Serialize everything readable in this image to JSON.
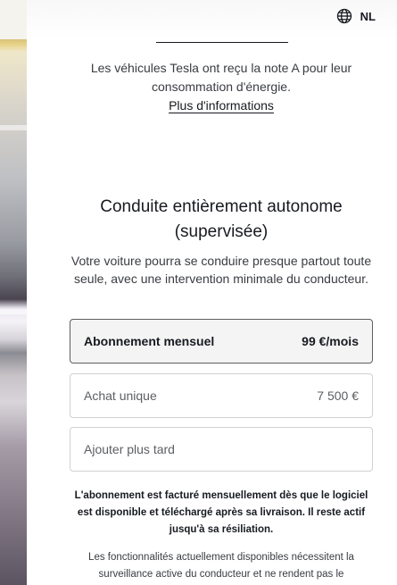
{
  "header": {
    "language_code": "NL",
    "globe_icon": "globe-icon"
  },
  "energy": {
    "note": "Les véhicules Tesla ont reçu la note A pour leur consommation d'énergie.",
    "link": "Plus d'informations"
  },
  "fsd": {
    "title": "Conduite entièrement autonome (supervisée)",
    "description": "Votre voiture pourra se conduire presque partout toute seule, avec une intervention minimale du conducteur.",
    "options": [
      {
        "label": "Abonnement mensuel",
        "price": "99 €/mois",
        "selected": true
      },
      {
        "label": "Achat unique",
        "price": "7 500 €",
        "selected": false
      },
      {
        "label": "Ajouter plus tard",
        "price": "",
        "selected": false
      }
    ],
    "billing_note": "L'abonnement est facturé mensuellement dès que le logiciel est disponible et téléchargé après sa livraison. Il reste actif jusqu'à sa résiliation.",
    "features_note": "Les fonctionnalités actuellement disponibles nécessitent la surveillance active du conducteur et ne rendent pas le"
  },
  "colors": {
    "text_primary": "#171a20",
    "text_secondary": "#393c41",
    "border": "#d0d1d2",
    "selected_border": "#5c5e62",
    "selected_bg": "#f4f4f4"
  }
}
